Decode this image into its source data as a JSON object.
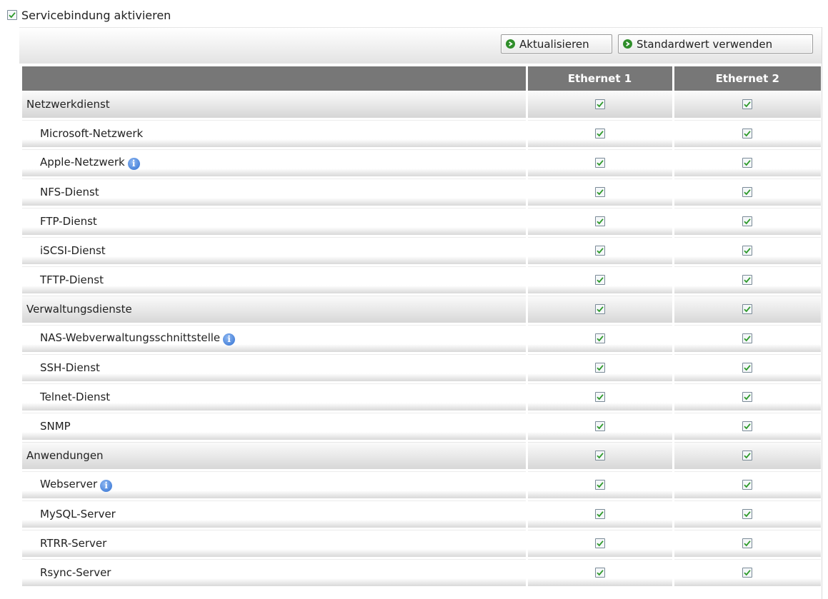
{
  "header": {
    "bind_label": "Servicebindung aktivieren",
    "bind_checked": true
  },
  "toolbar": {
    "refresh_label": "Aktualisieren",
    "default_label": "Standardwert verwenden"
  },
  "table": {
    "columns": [
      "",
      "Ethernet 1",
      "Ethernet 2"
    ],
    "rows": [
      {
        "label": "Netzwerkdienst",
        "type": "group",
        "eth1": true,
        "eth2": true
      },
      {
        "label": "Microsoft-Netzwerk",
        "type": "item",
        "eth1": true,
        "eth2": true
      },
      {
        "label": "Apple-Netzwerk",
        "type": "item",
        "info": true,
        "eth1": true,
        "eth2": true
      },
      {
        "label": "NFS-Dienst",
        "type": "item",
        "eth1": true,
        "eth2": true
      },
      {
        "label": "FTP-Dienst",
        "type": "item",
        "eth1": true,
        "eth2": true
      },
      {
        "label": "iSCSI-Dienst",
        "type": "item",
        "eth1": true,
        "eth2": true
      },
      {
        "label": "TFTP-Dienst",
        "type": "item",
        "eth1": true,
        "eth2": true
      },
      {
        "label": "Verwaltungsdienste",
        "type": "group",
        "eth1": true,
        "eth2": true
      },
      {
        "label": "NAS-Webverwaltungsschnittstelle",
        "type": "item",
        "info": true,
        "eth1": true,
        "eth2": true
      },
      {
        "label": "SSH-Dienst",
        "type": "item",
        "eth1": true,
        "eth2": true
      },
      {
        "label": "Telnet-Dienst",
        "type": "item",
        "eth1": true,
        "eth2": true
      },
      {
        "label": "SNMP",
        "type": "item",
        "eth1": true,
        "eth2": true
      },
      {
        "label": "Anwendungen",
        "type": "group",
        "eth1": true,
        "eth2": true
      },
      {
        "label": "Webserver",
        "type": "item",
        "info": true,
        "eth1": true,
        "eth2": true
      },
      {
        "label": "MySQL-Server",
        "type": "item",
        "eth1": true,
        "eth2": true
      },
      {
        "label": "RTRR-Server",
        "type": "item",
        "eth1": true,
        "eth2": true
      },
      {
        "label": "Rsync-Server",
        "type": "item",
        "eth1": true,
        "eth2": true
      }
    ]
  },
  "icons": {
    "checkbox": "checkmark-icon",
    "info": "info-icon",
    "button": "go-arrow-icon"
  },
  "colors": {
    "header_bg": "#777777",
    "check_green": "#2e9a2a",
    "button_icon": "#2f8e2a",
    "info_blue": "#2f6fd1"
  }
}
